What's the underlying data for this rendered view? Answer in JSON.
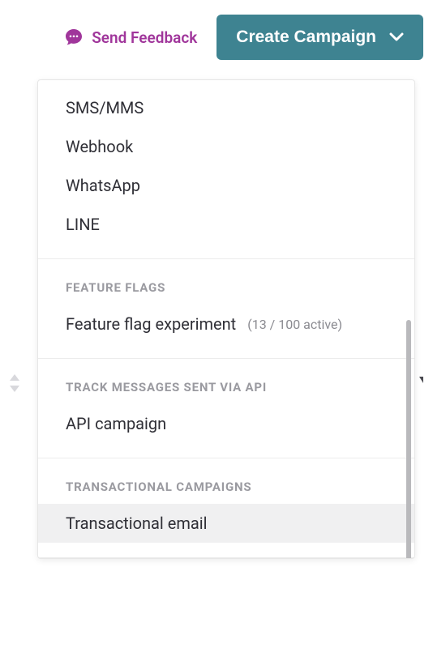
{
  "header": {
    "feedback_label": "Send Feedback",
    "create_label": "Create Campaign"
  },
  "dropdown": {
    "channels": {
      "items": [
        {
          "label": "SMS/MMS"
        },
        {
          "label": "Webhook"
        },
        {
          "label": "WhatsApp"
        },
        {
          "label": "LINE"
        }
      ]
    },
    "feature_flags": {
      "header": "FEATURE FLAGS",
      "item_label": "Feature flag experiment",
      "annotation": "(13 / 100 active)"
    },
    "api": {
      "header": "TRACK MESSAGES SENT VIA API",
      "item_label": "API campaign"
    },
    "transactional": {
      "header": "TRANSACTIONAL CAMPAIGNS",
      "item_label": "Transactional email"
    }
  }
}
